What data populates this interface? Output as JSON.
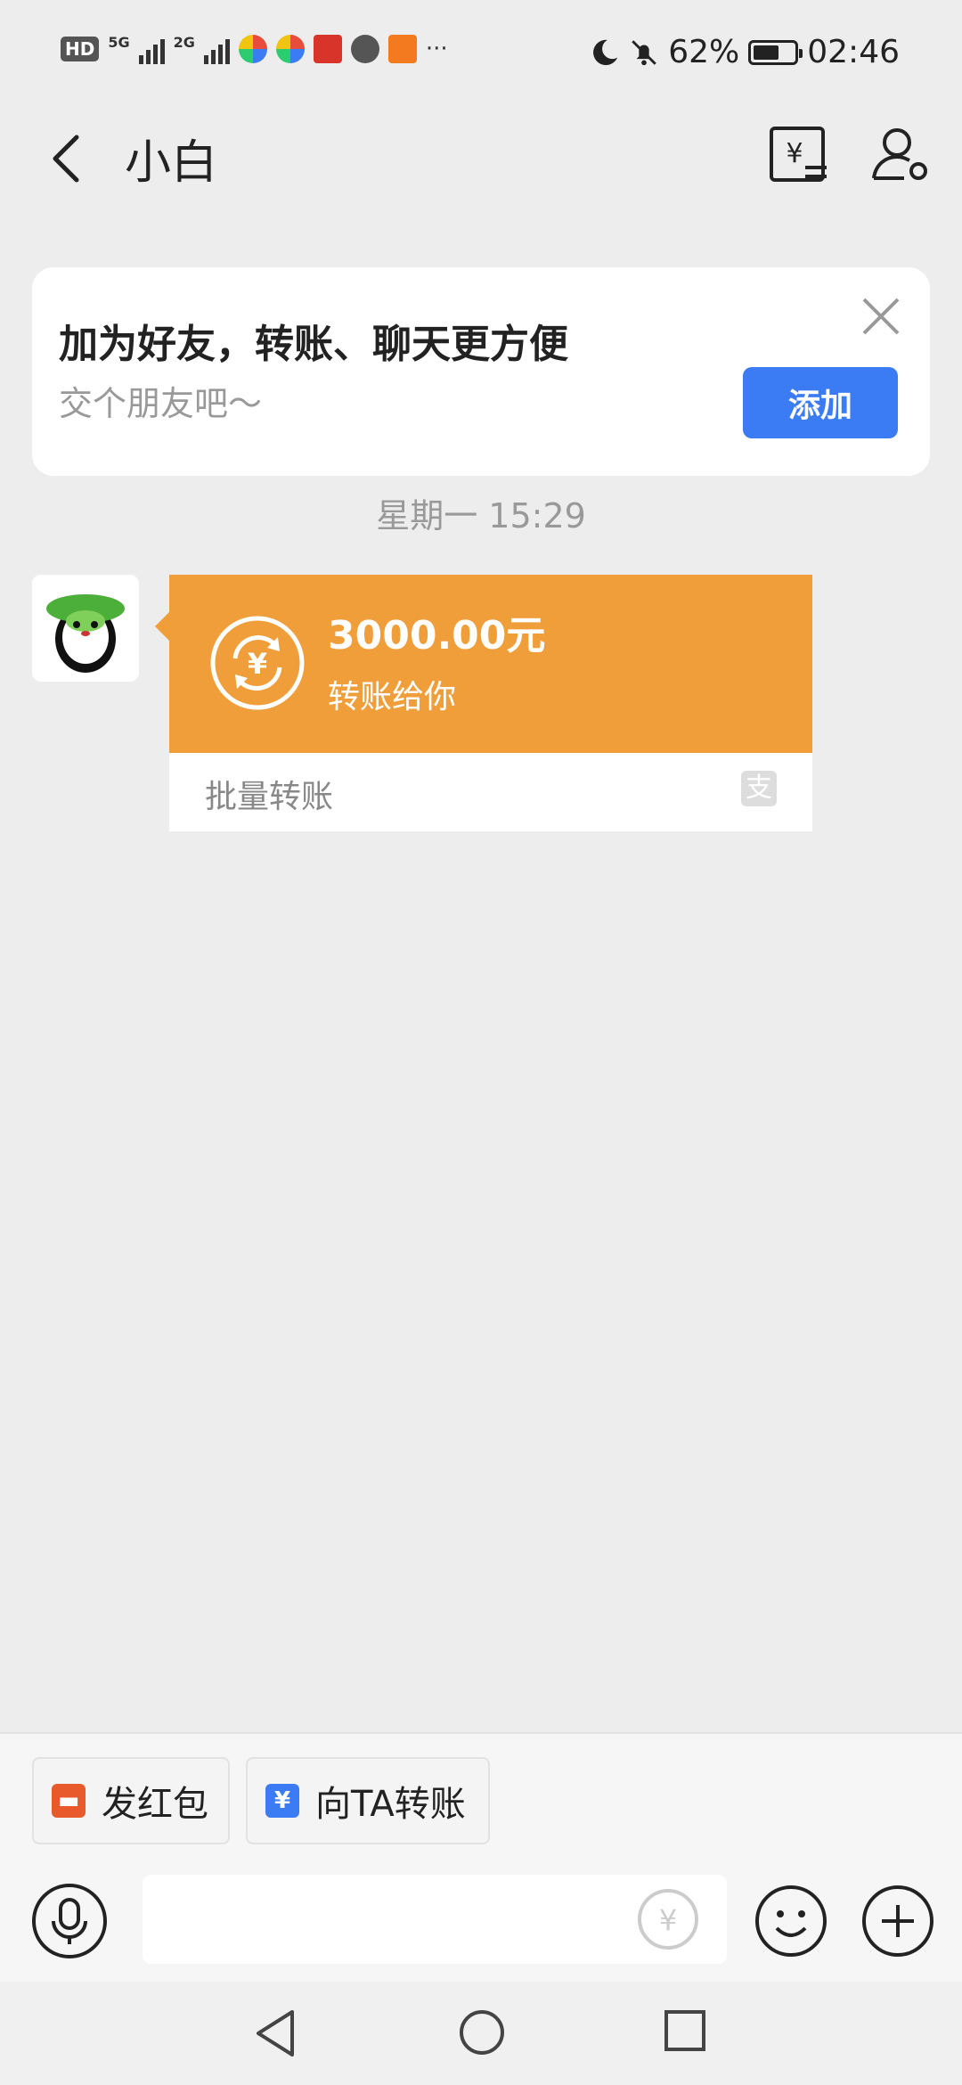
{
  "status_bar": {
    "network_1": "5G",
    "network_2": "2G",
    "battery": "62%",
    "time": "02:46",
    "more": "···"
  },
  "header": {
    "title": "小白"
  },
  "banner": {
    "heading": "加为好友，转账、聊天更方便",
    "subtext": "交个朋友吧～",
    "add_label": "添加"
  },
  "timestamp": "星期一 15:29",
  "message": {
    "amount": "3000.00元",
    "subtitle": "转账给你",
    "footer_label": "批量转账",
    "footer_icon_char": "支"
  },
  "quick_actions": {
    "red_packet": "发红包",
    "transfer": "向TA转账"
  },
  "colors": {
    "accent_blue": "#3b7cf4",
    "transfer_orange": "#f09e3a",
    "red_packet": "#e85a2c"
  },
  "battery_level": 0.62
}
